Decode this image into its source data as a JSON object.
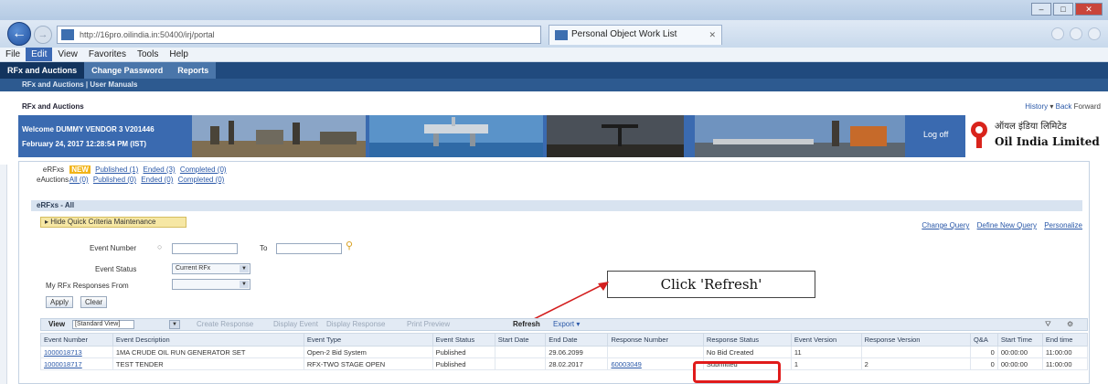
{
  "browser": {
    "url": "http://16pro.oilindia.in:50400/irj/portal",
    "tab_title": "Personal Object Work List",
    "menu": [
      "File",
      "Edit",
      "View",
      "Favorites",
      "Tools",
      "Help"
    ],
    "menu_active": "Edit"
  },
  "portal": {
    "tabs": [
      "RFx and Auctions",
      "Change Password",
      "Reports"
    ],
    "subnav": "RFx and Auctions  |  User Manuals",
    "breadcrumb": "RFx and Auctions",
    "history": "History",
    "back": "Back",
    "forward": "Forward",
    "welcome_line1": "Welcome DUMMY VENDOR 3 V201446",
    "welcome_line2": "February 24, 2017  12:28:54 PM (IST)",
    "logoff": "Log off",
    "brand_hindi": "ऑयल इंडिया लिमिटेड",
    "brand_name": "Oil India Limited"
  },
  "filters": {
    "erfx_label": "eRFxs",
    "erfx_new": "NEW",
    "erfx_links": [
      "Published (1)",
      "Ended (3)",
      "Completed (0)"
    ],
    "eauction_label": "eAuctions",
    "eauction_links": [
      "All (0)",
      "Published (0)",
      "Ended (0)",
      "Completed (0)"
    ]
  },
  "section": {
    "title": "eRFxs - All",
    "quick_criteria": "Hide Quick Criteria Maintenance",
    "top_links": [
      "Change Query",
      "Define New Query",
      "Personalize"
    ]
  },
  "form": {
    "event_number_label": "Event Number",
    "to_label": "To",
    "event_status_label": "Event Status",
    "event_status_value": "Current RFx",
    "responses_from_label": "My RFx Responses From",
    "apply": "Apply",
    "clear": "Clear"
  },
  "callout": "Click 'Refresh'",
  "toolbar": {
    "view_label": "View",
    "view_value": "[Standard View]",
    "create_response": "Create Response",
    "display_event": "Display Event",
    "display_response": "Display Response",
    "print_preview": "Print Preview",
    "refresh": "Refresh",
    "export": "Export"
  },
  "table": {
    "columns": [
      "Event Number",
      "Event Description",
      "Event Type",
      "Event Status",
      "Start Date",
      "End Date",
      "Response Number",
      "Response Status",
      "Event Version",
      "Response Version",
      "Q&A",
      "Start Time",
      "End time"
    ],
    "rows": [
      [
        "1000018713",
        "1MA CRUDE OIL RUN GENERATOR SET",
        "Open-2 Bid System",
        "Published",
        "",
        "29.06.2099",
        "",
        "No Bid Created",
        "11",
        "",
        "0",
        "00:00:00",
        "11:00:00"
      ],
      [
        "1000018717",
        "TEST TENDER",
        "RFX-TWO STAGE OPEN",
        "Published",
        "",
        "28.02.2017",
        "60003049",
        "Submitted",
        "1",
        "2",
        "0",
        "00:00:00",
        "11:00:00"
      ]
    ]
  }
}
